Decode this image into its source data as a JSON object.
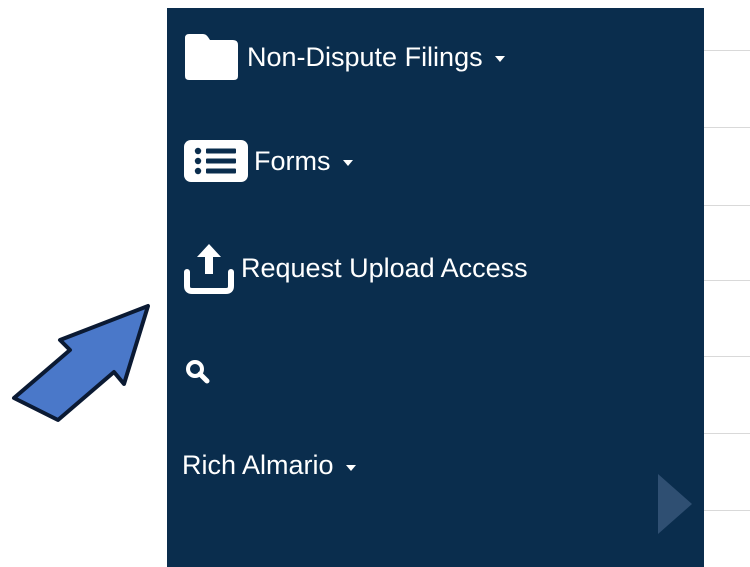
{
  "sidebar": {
    "items": [
      {
        "label": "Non-Dispute Filings",
        "icon": "folder-icon",
        "has_dropdown": true
      },
      {
        "label": "Forms",
        "icon": "list-icon",
        "has_dropdown": true
      },
      {
        "label": "Request Upload Access",
        "icon": "upload-icon",
        "has_dropdown": false
      },
      {
        "label": "",
        "icon": "search-icon",
        "has_dropdown": false
      },
      {
        "label": "Rich Almario",
        "icon": "",
        "has_dropdown": true
      }
    ]
  },
  "colors": {
    "sidebar_bg": "#0a2d4d",
    "text": "#ffffff",
    "annotation_arrow": "#4a78c9",
    "scroll_indicator": "#2f4f72"
  },
  "annotation": {
    "icon": "arrow-pointer-icon"
  }
}
